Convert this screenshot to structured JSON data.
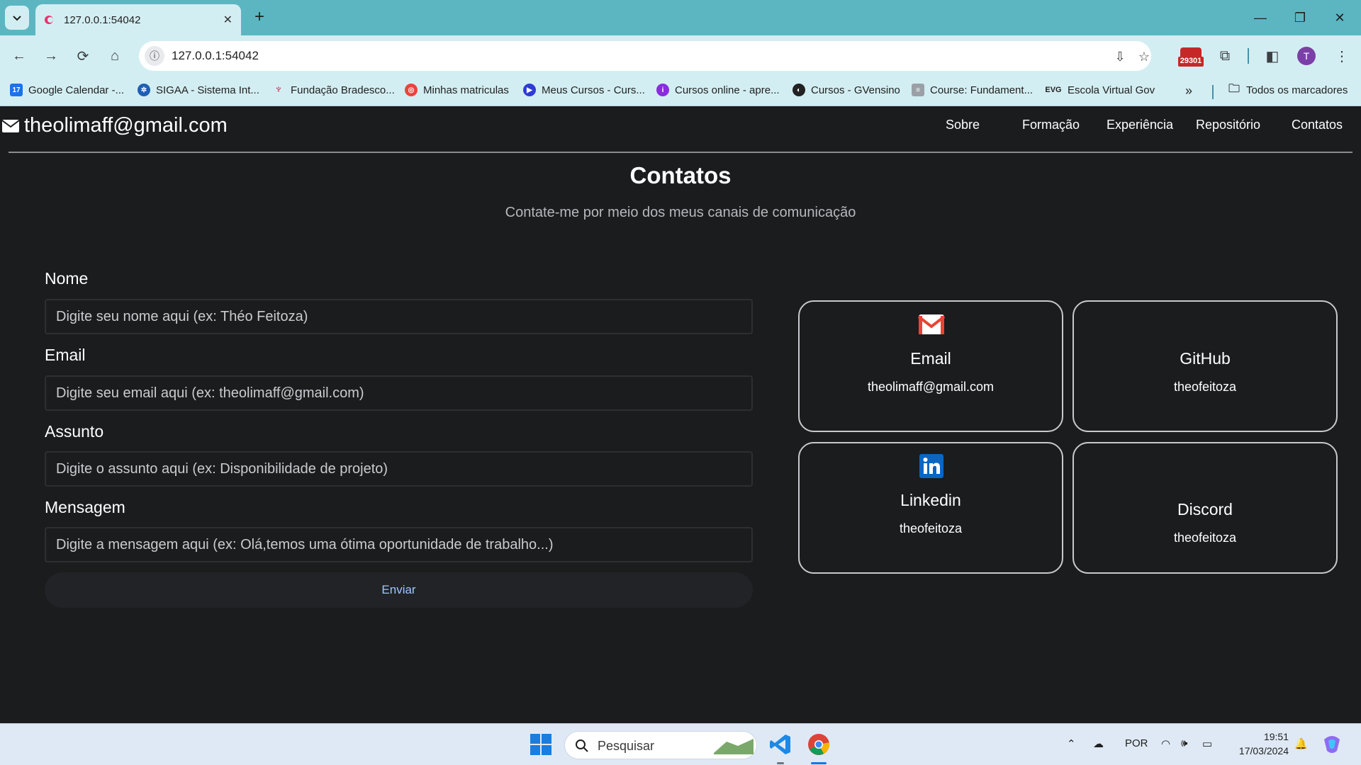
{
  "browser": {
    "tab_title": "127.0.0.1:54042",
    "url": "127.0.0.1:54042",
    "extension_badge": "29301",
    "profile_initial": "T",
    "bookmarks": [
      {
        "label": "Google Calendar -...",
        "icon": "calendar-icon",
        "color": "#1a73e8"
      },
      {
        "label": "SIGAA - Sistema Int...",
        "icon": "sigaa-icon",
        "color": "#1f5fb5"
      },
      {
        "label": "Fundação Bradesco...",
        "icon": "bradesco-icon",
        "color": "#cc092f"
      },
      {
        "label": "Minhas matriculas",
        "icon": "matriculas-icon",
        "color": "#e8453c"
      },
      {
        "label": "Meus Cursos - Curs...",
        "icon": "cursos-icon",
        "color": "#2f3bd6"
      },
      {
        "label": "Cursos online - apre...",
        "icon": "cursos-online-icon",
        "color": "#8a2be2"
      },
      {
        "label": "Cursos - GVensino",
        "icon": "gvensino-icon",
        "color": "#222222"
      },
      {
        "label": "Course: Fundament...",
        "icon": "course-icon",
        "color": "#9aa0a6"
      },
      {
        "label": "Escola Virtual Gov",
        "icon": "evg-icon",
        "color": "#1f1f1f"
      }
    ],
    "all_bookmarks_label": "Todos os marcadores"
  },
  "site": {
    "brand_email": "theolimaff@gmail.com",
    "nav": [
      "Sobre",
      "Formação",
      "Experiência",
      "Repositório",
      "Contatos"
    ]
  },
  "section": {
    "title": "Contatos",
    "subtitle": "Contate-me por meio dos meus canais de comunicação"
  },
  "form": {
    "name_label": "Nome",
    "name_placeholder": "Digite seu nome aqui (ex: Théo Feitoza)",
    "email_label": "Email",
    "email_placeholder": "Digite seu email aqui (ex: theolimaff@gmail.com)",
    "subject_label": "Assunto",
    "subject_placeholder": "Digite o assunto aqui (ex: Disponibilidade de projeto)",
    "message_label": "Mensagem",
    "message_placeholder": "Digite a mensagem aqui (ex: Olá,temos uma ótima oportunidade de trabalho...)",
    "submit_label": "Enviar"
  },
  "contacts": [
    {
      "title": "Email",
      "value": "theolimaff@gmail.com",
      "icon": "gmail-icon"
    },
    {
      "title": "GitHub",
      "value": "theofeitoza",
      "icon": ""
    },
    {
      "title": "Linkedin",
      "value": "theofeitoza",
      "icon": "linkedin-icon"
    },
    {
      "title": "Discord",
      "value": "theofeitoza",
      "icon": ""
    }
  ],
  "taskbar": {
    "search_placeholder": "Pesquisar",
    "language": "POR",
    "time": "19:51",
    "date": "17/03/2024"
  },
  "colors": {
    "tabbar": "#5cb6c2",
    "chrome": "#d3eef2",
    "page_bg": "#1b1c1e",
    "send_text": "#9ec6ff"
  }
}
